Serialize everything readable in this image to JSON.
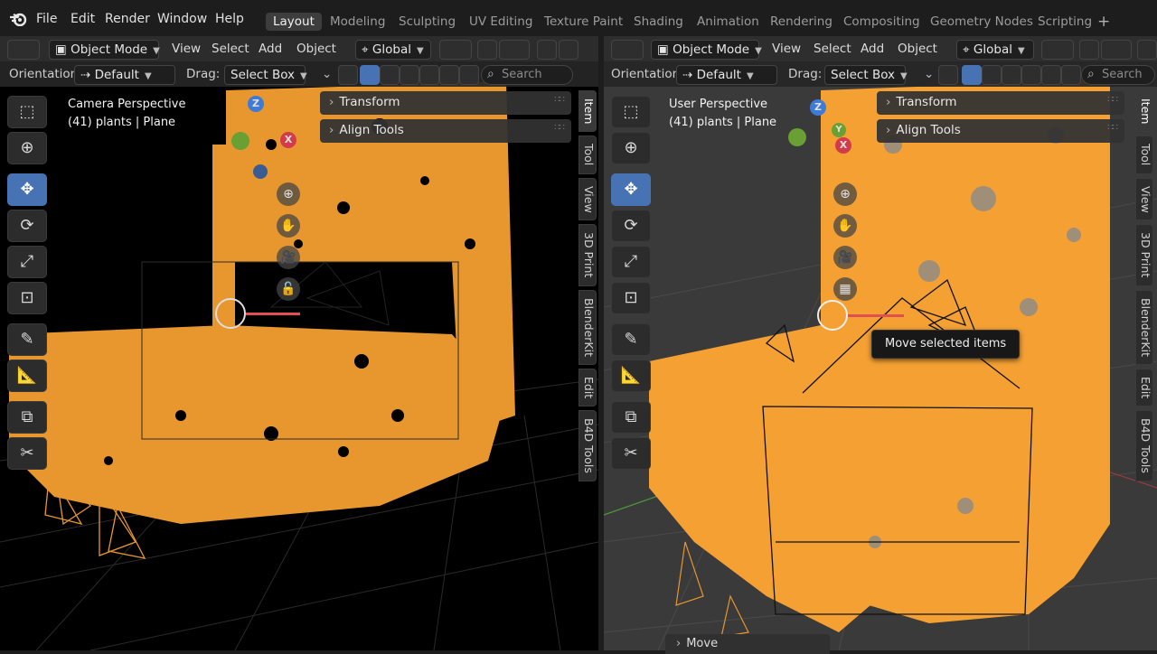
{
  "menu": [
    "File",
    "Edit",
    "Render",
    "Window",
    "Help"
  ],
  "workspaces": [
    "Layout",
    "Modeling",
    "Sculpting",
    "UV Editing",
    "Texture Paint",
    "Shading",
    "Animation",
    "Rendering",
    "Compositing",
    "Geometry Nodes",
    "Scripting"
  ],
  "add_workspace": "+",
  "header": {
    "mode": "Object Mode",
    "view": "View",
    "select": "Select",
    "add": "Add",
    "object": "Object",
    "transform_space": "Global"
  },
  "tool_header": {
    "orientation_label": "Orientation:",
    "orientation_value": "Default",
    "drag_label": "Drag:",
    "drag_value": "Select Box",
    "search_placeholder": "Search"
  },
  "left_viewport": {
    "title": "Camera Perspective",
    "subtitle": "(41) plants | Plane"
  },
  "right_viewport": {
    "title": "User Perspective",
    "subtitle": "(41) plants | Plane"
  },
  "panels": {
    "transform": "Transform",
    "align_tools": "Align Tools"
  },
  "sidebar_tabs": [
    "Item",
    "Tool",
    "View",
    "3D Print",
    "BlenderKit",
    "Edit",
    "B4D Tools"
  ],
  "gizmo": {
    "z": "Z",
    "x": "X",
    "y": "Y"
  },
  "tooltip": "Move selected items",
  "operator_panel": "Move",
  "colors": {
    "selection": "#f5a033",
    "active_tool": "#4772b3"
  }
}
